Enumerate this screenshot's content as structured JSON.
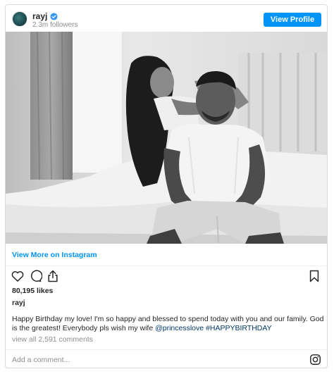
{
  "header": {
    "username": "rayj",
    "followers": "2.3m followers",
    "view_profile_label": "View Profile"
  },
  "links": {
    "view_more_label": "View More on Instagram"
  },
  "post": {
    "likes": "80,195 likes",
    "owner": "rayj",
    "caption_text": "Happy Birthday my love! I'm so happy and blessed to spend today with you and our family. God is the greatest! Everybody pls wish my wife ",
    "mention": "@princesslove",
    "hashtag": "#HAPPYBIRTHDAY",
    "comments_link": "view all 2,591 comments"
  },
  "comment_box": {
    "placeholder": "Add a comment..."
  },
  "icons": {
    "like": "heart-icon",
    "comment": "comment-icon",
    "share": "share-icon",
    "save": "bookmark-icon",
    "verified": "verified-badge-icon",
    "instagram": "instagram-logo-icon"
  },
  "colors": {
    "accent": "#0095f6",
    "hashtag": "#00376b",
    "muted": "#8e8e8e"
  }
}
